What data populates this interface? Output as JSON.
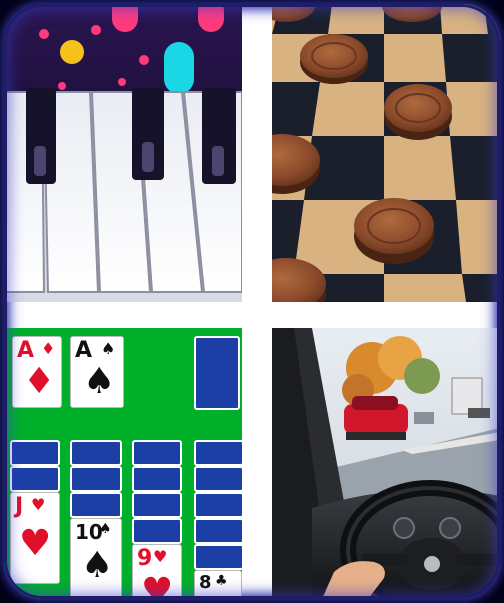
{
  "tiles": [
    {
      "id": "piano",
      "name": "Piano"
    },
    {
      "id": "checkers",
      "name": "Checkers"
    },
    {
      "id": "solitaire",
      "name": "Solitaire"
    },
    {
      "id": "driving",
      "name": "Driving"
    }
  ],
  "solitaire": {
    "foundation": [
      {
        "rank": "A",
        "suit": "♦",
        "color": "red"
      },
      {
        "rank": "A",
        "suit": "♠",
        "color": "black"
      }
    ],
    "tableau": [
      {
        "rank": "J",
        "suit": "♥",
        "color": "red"
      },
      {
        "rank": "10",
        "suit": "♠",
        "color": "black"
      },
      {
        "rank": "9",
        "suit": "♥",
        "color": "red"
      },
      {
        "rank": "8",
        "suit": "♣",
        "color": "black"
      }
    ]
  },
  "colors": {
    "background": "#02021a",
    "border_glow": "#3a3aa8",
    "felt_green": "#00b02a",
    "card_back": "#1c3fa6",
    "checker_piece": "#8b4a2b"
  }
}
